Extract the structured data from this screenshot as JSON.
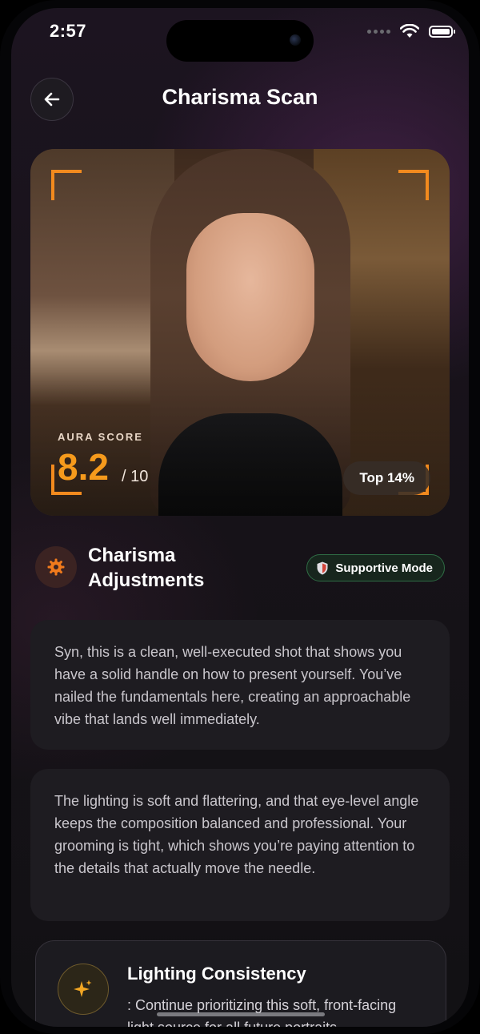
{
  "status_bar": {
    "time": "2:57",
    "signal_icon": "cellular-signal-icon",
    "wifi_icon": "wifi-icon",
    "battery_icon": "battery-icon"
  },
  "header": {
    "back_icon": "arrow-left-icon",
    "title": "Charisma Scan"
  },
  "photo_card": {
    "aura_label": "AURA SCORE",
    "aura_score": "8.2",
    "aura_out_of": "/ 10",
    "rank_badge": "Top 14%",
    "accent_color": "#f28a1e"
  },
  "section": {
    "icon": "gear-icon",
    "title": "Charisma Adjustments",
    "mode_icon": "shield-icon",
    "mode_label": "Supportive Mode"
  },
  "cards": [
    {
      "text": "Syn, this is a clean, well-executed shot that shows you have a solid handle on how to present yourself. You’ve nailed the fundamentals here, creating an approachable vibe that lands well immediately."
    },
    {
      "text": "The lighting is soft and flattering, and that eye-level angle keeps the composition balanced and professional. Your grooming is tight, which shows you’re paying attention to the details that actually move the needle."
    }
  ],
  "tip": {
    "icon": "sparkle-icon",
    "title": "Lighting Consistency",
    "body": ": Continue prioritizing this soft, front-facing light source for all future portraits."
  },
  "colors": {
    "accent_orange": "#f59a1c",
    "mode_green": "#2f6d45",
    "background": "#161218"
  }
}
